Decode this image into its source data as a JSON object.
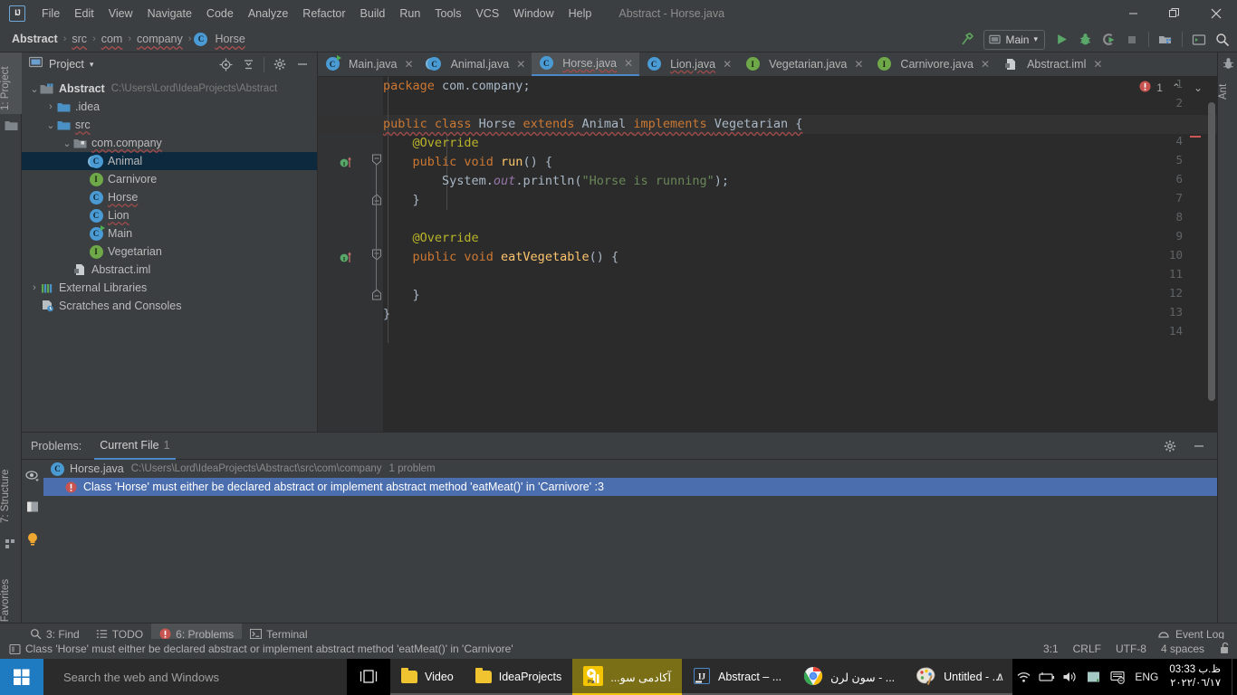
{
  "window": {
    "title": "Abstract - Horse.java",
    "logo": "intellij-idea-logo",
    "controls": {
      "minimize": "—",
      "maximize": "❐",
      "close": "✕"
    }
  },
  "menu": {
    "items": [
      "File",
      "Edit",
      "View",
      "Navigate",
      "Code",
      "Analyze",
      "Refactor",
      "Build",
      "Run",
      "Tools",
      "VCS",
      "Window",
      "Help"
    ]
  },
  "breadcrumbs": {
    "items": [
      {
        "label": "Abstract",
        "bold": true,
        "squiggle": false,
        "icon": ""
      },
      {
        "label": "src",
        "bold": false,
        "squiggle": true,
        "icon": ""
      },
      {
        "label": "com",
        "bold": false,
        "squiggle": true,
        "icon": ""
      },
      {
        "label": "company",
        "bold": false,
        "squiggle": true,
        "icon": ""
      },
      {
        "label": "Horse",
        "bold": false,
        "squiggle": true,
        "icon": "class-icon"
      }
    ],
    "separator": "›"
  },
  "toolbar": {
    "run_config": "Main",
    "dropdown_arrow": "▾",
    "icons": [
      "build-hammer-icon",
      "run-icon",
      "debug-icon",
      "run-coverage-icon",
      "stop-icon",
      "project-structure-icon",
      "terminal-icon",
      "search-everywhere-icon"
    ]
  },
  "left_tool_strip": {
    "top": [
      {
        "label": "1: Project",
        "active": true,
        "icon": "project-icon"
      }
    ],
    "bottom": [
      {
        "label": "7: Structure",
        "icon": "structure-icon"
      },
      {
        "label": "2: Favorites",
        "icon": "favorites-star-icon"
      }
    ]
  },
  "right_tool_strip": {
    "items": [
      {
        "label": "Ant",
        "icon": "ant-icon"
      }
    ]
  },
  "project_panel": {
    "title": "Project",
    "dropdown": "▾",
    "header_icons": [
      "locate-icon",
      "collapse-all-icon",
      "settings-gear-icon",
      "hide-icon"
    ],
    "tree": [
      {
        "depth": 0,
        "arrow": "⌄",
        "icon": "module-icon",
        "label": "Abstract",
        "bold": true,
        "path": "C:\\Users\\Lord\\IdeaProjects\\Abstract",
        "selected": false,
        "squiggle": false
      },
      {
        "depth": 1,
        "arrow": "›",
        "icon": "folder-icon",
        "label": ".idea",
        "bold": false,
        "path": "",
        "selected": false,
        "squiggle": false
      },
      {
        "depth": 1,
        "arrow": "⌄",
        "icon": "source-folder-icon",
        "label": "src",
        "bold": false,
        "path": "",
        "selected": false,
        "squiggle": true
      },
      {
        "depth": 2,
        "arrow": "⌄",
        "icon": "package-icon",
        "label": "com.company",
        "bold": false,
        "path": "",
        "selected": false,
        "squiggle": true
      },
      {
        "depth": 3,
        "arrow": "",
        "icon": "abstract-class-icon",
        "label": "Animal",
        "bold": false,
        "path": "",
        "selected": true,
        "squiggle": false
      },
      {
        "depth": 3,
        "arrow": "",
        "icon": "interface-icon",
        "label": "Carnivore",
        "bold": false,
        "path": "",
        "selected": false,
        "squiggle": false
      },
      {
        "depth": 3,
        "arrow": "",
        "icon": "class-icon",
        "label": "Horse",
        "bold": false,
        "path": "",
        "selected": false,
        "squiggle": true
      },
      {
        "depth": 3,
        "arrow": "",
        "icon": "class-icon",
        "label": "Lion",
        "bold": false,
        "path": "",
        "selected": false,
        "squiggle": true
      },
      {
        "depth": 3,
        "arrow": "",
        "icon": "main-class-icon",
        "label": "Main",
        "bold": false,
        "path": "",
        "selected": false,
        "squiggle": false
      },
      {
        "depth": 3,
        "arrow": "",
        "icon": "interface-icon",
        "label": "Vegetarian",
        "bold": false,
        "path": "",
        "selected": false,
        "squiggle": false
      },
      {
        "depth": 2,
        "arrow": "",
        "icon": "iml-file-icon",
        "label": "Abstract.iml",
        "bold": false,
        "path": "",
        "selected": false,
        "squiggle": false
      },
      {
        "depth": 0,
        "arrow": "›",
        "icon": "external-libraries-icon",
        "label": "External Libraries",
        "bold": false,
        "path": "",
        "selected": false,
        "squiggle": false
      },
      {
        "depth": 0,
        "arrow": "",
        "icon": "scratches-icon",
        "label": "Scratches and Consoles",
        "bold": false,
        "path": "",
        "selected": false,
        "squiggle": false
      }
    ]
  },
  "editor_tabs": [
    {
      "label": "Main.java",
      "icon": "main-class-icon",
      "active": false,
      "squiggle": false
    },
    {
      "label": "Animal.java",
      "icon": "abstract-class-icon",
      "active": false,
      "squiggle": false
    },
    {
      "label": "Horse.java",
      "icon": "class-icon",
      "active": true,
      "squiggle": true
    },
    {
      "label": "Lion.java",
      "icon": "class-icon",
      "active": false,
      "squiggle": true
    },
    {
      "label": "Vegetarian.java",
      "icon": "interface-icon",
      "active": false,
      "squiggle": false
    },
    {
      "label": "Carnivore.java",
      "icon": "interface-icon",
      "active": false,
      "squiggle": false
    },
    {
      "label": "Abstract.iml",
      "icon": "iml-file-icon",
      "active": false,
      "squiggle": false
    }
  ],
  "editor": {
    "inspection_error_count": "1",
    "inspection_up": "⌃",
    "inspection_down": "⌄",
    "line_count": 14,
    "lines": [
      {
        "n": 1,
        "text": "package com.company;"
      },
      {
        "n": 2,
        "text": ""
      },
      {
        "n": 3,
        "text": "public class Horse extends Animal implements Vegetarian {"
      },
      {
        "n": 4,
        "text": "    @Override"
      },
      {
        "n": 5,
        "text": "    public void run() {"
      },
      {
        "n": 6,
        "text": "        System.out.println(\"Horse is running\");"
      },
      {
        "n": 7,
        "text": "    }"
      },
      {
        "n": 8,
        "text": ""
      },
      {
        "n": 9,
        "text": "    @Override"
      },
      {
        "n": 10,
        "text": "    public void eatVegetable() {"
      },
      {
        "n": 11,
        "text": ""
      },
      {
        "n": 12,
        "text": "    }"
      },
      {
        "n": 13,
        "text": "}"
      },
      {
        "n": 14,
        "text": ""
      }
    ],
    "gutter_markers": [
      {
        "line": 5,
        "icon": "implementing-method-icon"
      },
      {
        "line": 10,
        "icon": "implementing-method-icon"
      }
    ]
  },
  "problems_panel": {
    "label": "Problems:",
    "tab": "Current File",
    "tab_count": "1",
    "header_icons": [
      "settings-gear-icon",
      "hide-icon"
    ],
    "side_icons": [
      "preview-eye-icon",
      "open-editor-icon",
      "lightbulb-icon"
    ],
    "file_row": {
      "icon": "class-icon",
      "name": "Horse.java",
      "path": "C:\\Users\\Lord\\IdeaProjects\\Abstract\\src\\com\\company",
      "count": "1 problem"
    },
    "problem_row": {
      "icon": "error-icon",
      "text": "Class 'Horse' must either be declared abstract or implement abstract method 'eatMeat()' in 'Carnivore' :3",
      "selected": true
    }
  },
  "bottom_bar": {
    "tabs": [
      {
        "label": "3: Find",
        "icon": "search-icon",
        "active": false,
        "underline": "3"
      },
      {
        "label": "TODO",
        "icon": "todo-icon",
        "active": false,
        "underline": ""
      },
      {
        "label": "6: Problems",
        "icon": "error-icon",
        "active": true,
        "underline": "6"
      },
      {
        "label": "Terminal",
        "icon": "terminal-icon",
        "active": false,
        "underline": ""
      }
    ],
    "event_log": "Event Log",
    "event_log_icon": "event-log-icon"
  },
  "status_bar": {
    "message": "Class 'Horse' must either be declared abstract or implement abstract method 'eatMeat()' in 'Carnivore'",
    "message_icon": "message-icon",
    "position": "3:1",
    "line_separator": "CRLF",
    "encoding": "UTF-8",
    "indent": "4 spaces",
    "lock_icon": "unlocked-icon"
  },
  "taskbar": {
    "start_icon": "windows-start-icon",
    "search_placeholder": "Search the web and Windows",
    "taskview_icon": "task-view-icon",
    "buttons": [
      {
        "label": "Video",
        "icon": "folder-icon",
        "state": "open"
      },
      {
        "label": "IdeaProjects",
        "icon": "folder-icon",
        "state": "open"
      },
      {
        "label": "آکادمی سو...",
        "icon": "potplayer-icon",
        "state": "active"
      },
      {
        "label": "Abstract – ...",
        "icon": "intellij-icon",
        "state": "open"
      },
      {
        "label": "... - سون لرن",
        "icon": "chrome-icon",
        "state": "open"
      },
      {
        "label": "Untitled - ...",
        "icon": "paint-icon",
        "state": "open"
      }
    ],
    "tray": {
      "chevron": "∧",
      "icons": [
        "wifi-icon",
        "battery-icon",
        "volume-icon",
        "display-icon",
        "action-center-icon"
      ],
      "language": "ENG",
      "time": "03:33 ظ.ب",
      "date": "٢٠٢٢/٠٦/١٧"
    }
  },
  "colors": {
    "chrome": "#3c3f41",
    "editor_bg": "#2b2b2b",
    "gutter_bg": "#313335",
    "selection_blue": "#4b6eaf",
    "tree_selection": "#0d293e",
    "accent_blue": "#4a88c7",
    "error_red": "#cc5555",
    "keyword_orange": "#cc7832",
    "string_green": "#6a8759",
    "annotation_yellow": "#bbb529",
    "field_purple": "#9876aa",
    "method_yellow": "#ffc66d",
    "taskbar_black": "#000000"
  }
}
